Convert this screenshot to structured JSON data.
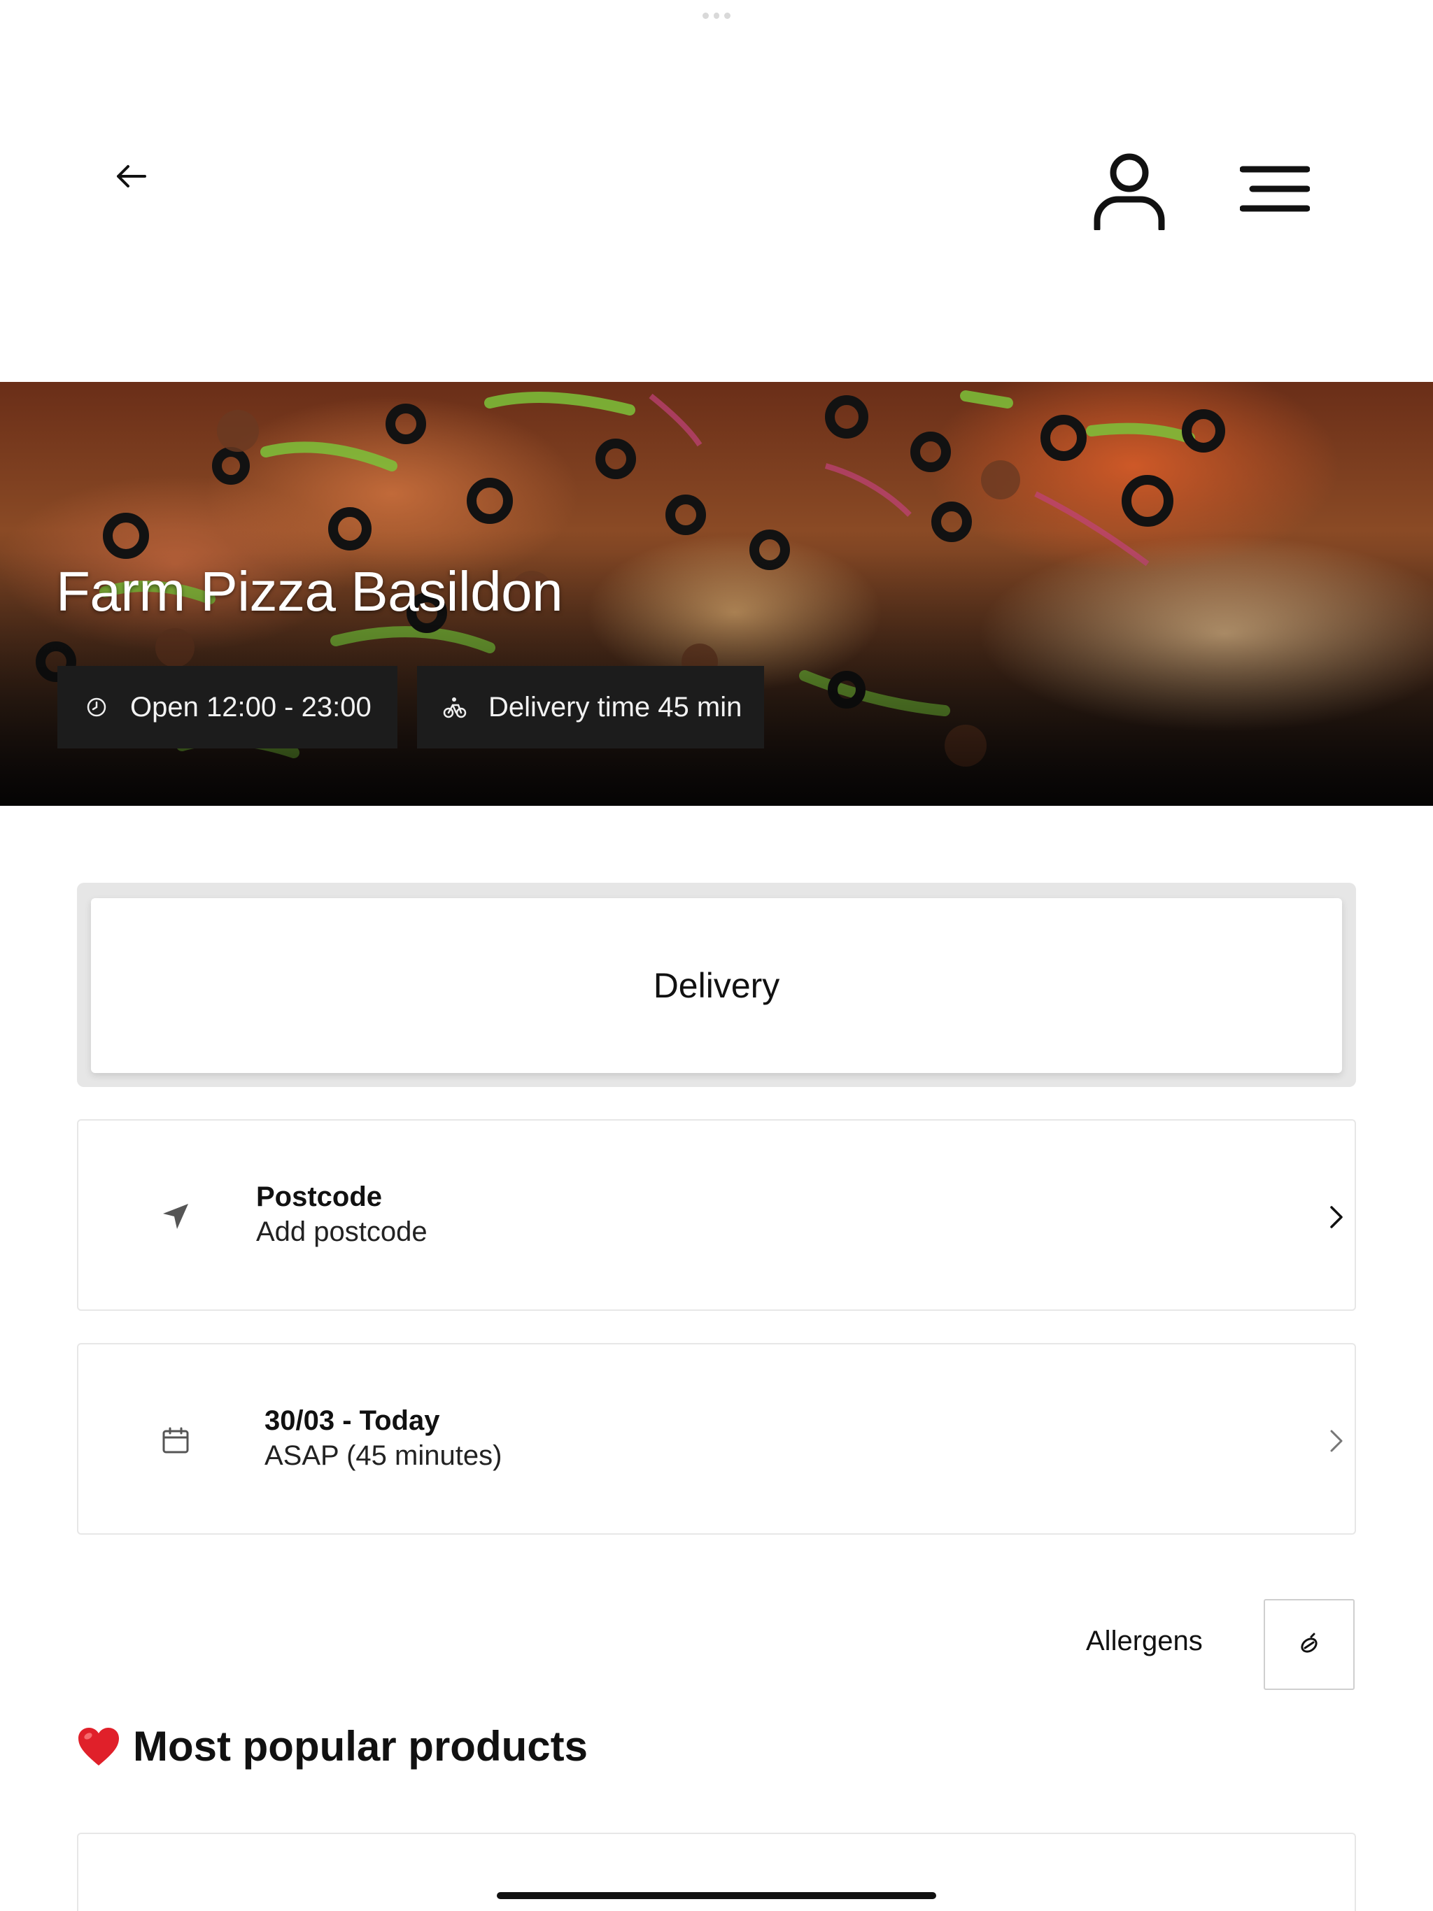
{
  "header": {
    "back_icon": "arrow-left-icon",
    "user_icon": "user-icon",
    "menu_icon": "menu-icon"
  },
  "hero": {
    "restaurant_name": "Farm Pizza Basildon",
    "opening_hours": "Open 12:00 - 23:00",
    "delivery_time": "Delivery time 45 min",
    "clock_icon": "clock-icon",
    "bike_icon": "bicycle-icon"
  },
  "order_mode": {
    "selected": "Delivery"
  },
  "postcode_card": {
    "title": "Postcode",
    "subtitle": "Add postcode",
    "icon": "location-arrow-icon"
  },
  "date_card": {
    "title": "30/03 - Today",
    "subtitle": "ASAP (45 minutes)",
    "icon": "calendar-icon"
  },
  "allergens": {
    "label": "Allergens",
    "icon": "allergen-icon"
  },
  "popular": {
    "emoji": "❤️",
    "heading": "Most popular products"
  },
  "colors": {
    "pill_background": "#1c1c1c",
    "heart_red": "#e0202a",
    "border_gray": "#e7e7e7"
  }
}
